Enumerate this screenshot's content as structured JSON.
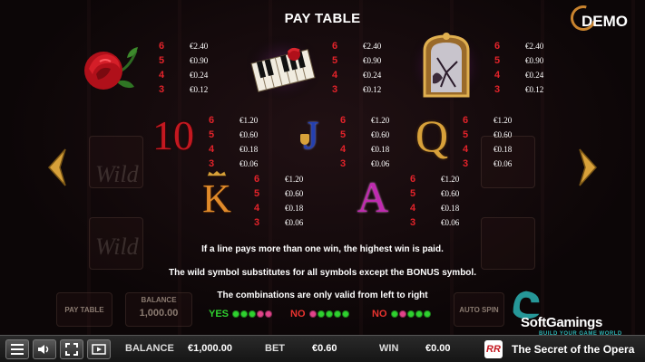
{
  "header": {
    "title": "PAY TABLE",
    "demo_label": "DEMO"
  },
  "symbols": {
    "rose": {
      "pays": [
        {
          "n": "6",
          "v": "€2.40"
        },
        {
          "n": "5",
          "v": "€0.90"
        },
        {
          "n": "4",
          "v": "€0.24"
        },
        {
          "n": "3",
          "v": "€0.12"
        }
      ]
    },
    "piano": {
      "pays": [
        {
          "n": "6",
          "v": "€2.40"
        },
        {
          "n": "5",
          "v": "€0.90"
        },
        {
          "n": "4",
          "v": "€0.24"
        },
        {
          "n": "3",
          "v": "€0.12"
        }
      ]
    },
    "mirror": {
      "pays": [
        {
          "n": "6",
          "v": "€2.40"
        },
        {
          "n": "5",
          "v": "€0.90"
        },
        {
          "n": "4",
          "v": "€0.24"
        },
        {
          "n": "3",
          "v": "€0.12"
        }
      ]
    },
    "ten": {
      "glyph": "10",
      "pays": [
        {
          "n": "6",
          "v": "€1.20"
        },
        {
          "n": "5",
          "v": "€0.60"
        },
        {
          "n": "4",
          "v": "€0.18"
        },
        {
          "n": "3",
          "v": "€0.06"
        }
      ]
    },
    "jack": {
      "glyph": "J",
      "pays": [
        {
          "n": "6",
          "v": "€1.20"
        },
        {
          "n": "5",
          "v": "€0.60"
        },
        {
          "n": "4",
          "v": "€0.18"
        },
        {
          "n": "3",
          "v": "€0.06"
        }
      ]
    },
    "queen": {
      "glyph": "Q",
      "pays": [
        {
          "n": "6",
          "v": "€1.20"
        },
        {
          "n": "5",
          "v": "€0.60"
        },
        {
          "n": "4",
          "v": "€0.18"
        },
        {
          "n": "3",
          "v": "€0.06"
        }
      ]
    },
    "king": {
      "glyph": "K",
      "pays": [
        {
          "n": "6",
          "v": "€1.20"
        },
        {
          "n": "5",
          "v": "€0.60"
        },
        {
          "n": "4",
          "v": "€0.18"
        },
        {
          "n": "3",
          "v": "€0.06"
        }
      ]
    },
    "ace": {
      "glyph": "A",
      "pays": [
        {
          "n": "6",
          "v": "€1.20"
        },
        {
          "n": "5",
          "v": "€0.60"
        },
        {
          "n": "4",
          "v": "€0.18"
        },
        {
          "n": "3",
          "v": "€0.06"
        }
      ]
    }
  },
  "notes": {
    "line1": "If a line pays more than one win, the highest win is paid.",
    "line2": "The wild symbol substitutes for all symbols except the BONUS symbol.",
    "line3": "The combinations are only valid from left to right"
  },
  "combos": [
    {
      "label": "YES",
      "color": "#2fd12f",
      "dots": [
        "#2fd12f",
        "#2fd12f",
        "#2fd12f",
        "#e0448a",
        "#e0448a"
      ]
    },
    {
      "label": "NO",
      "color": "#e8332f",
      "dots": [
        "#e0448a",
        "#2fd12f",
        "#2fd12f",
        "#2fd12f",
        "#2fd12f"
      ]
    },
    {
      "label": "NO",
      "color": "#e8332f",
      "dots": [
        "#2fd12f",
        "#e0448a",
        "#2fd12f",
        "#2fd12f",
        "#2fd12f"
      ]
    }
  ],
  "bottom_bar": {
    "balance_label": "BALANCE",
    "balance_value": "€1,000.00",
    "bet_label": "BET",
    "bet_value": "€0.60",
    "win_label": "WIN",
    "win_value": "€0.00",
    "game_title": "The Secret of the Opera"
  },
  "brand": {
    "name": "SoftGamings",
    "tagline": "BUILD YOUR GAME WORLD",
    "rr_badge": "RR"
  },
  "background_labels": {
    "paytable": "PAY TABLE",
    "balance": "BALANCE",
    "balance_value": "1,000.00",
    "autospin": "AUTO SPIN",
    "wild": "Wild"
  },
  "colors": {
    "accent_red": "#e2232a",
    "gold": "#d8a13a",
    "yes_green": "#2fd12f",
    "no_red": "#e8332f"
  }
}
